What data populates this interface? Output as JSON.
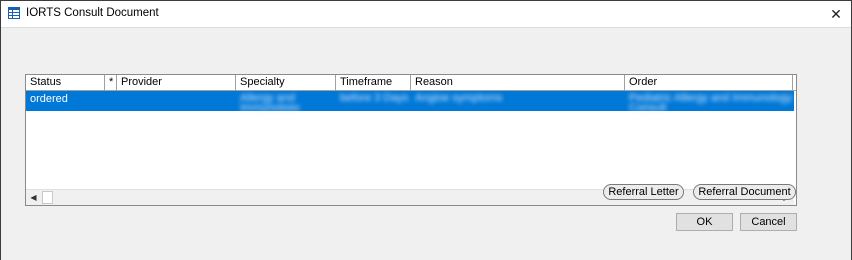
{
  "window": {
    "title": "IORTS Consult Document",
    "close_symbol": "✕"
  },
  "table": {
    "columns": [
      "Status",
      "*",
      "Provider",
      "Specialty",
      "Timeframe",
      "Reason",
      "Order"
    ],
    "rows": [
      {
        "status": "ordered",
        "star": "",
        "provider": "",
        "specialty": "Allergy and Immunology",
        "timeframe": "before 3 Days",
        "reason": "Angioe symptoms",
        "order": "Pediatric Allergy and Immunology Consult",
        "selected": true
      }
    ]
  },
  "scrollbar": {
    "left_arrow": "◀",
    "right_arrow": "▶"
  },
  "buttons": {
    "referral_letter": "Referral Letter",
    "referral_document": "Referral Document",
    "ok": "OK",
    "cancel": "Cancel"
  },
  "colors": {
    "selection": "#0078d7",
    "dialog_background": "#f0f0f0"
  }
}
